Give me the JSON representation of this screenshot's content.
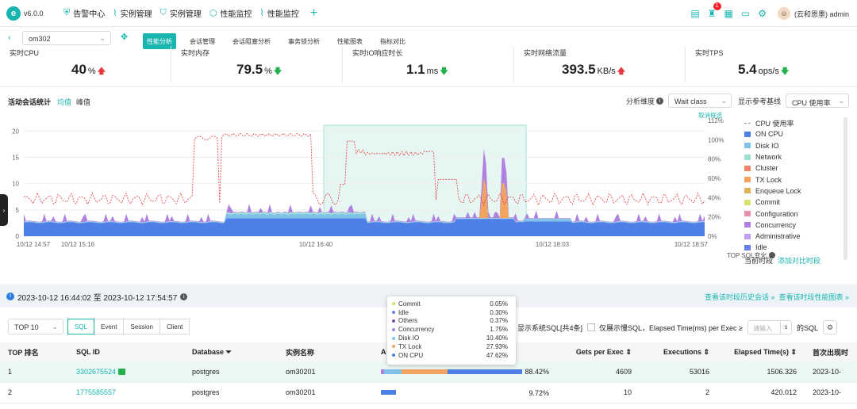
{
  "app": {
    "version": "v6.0.0",
    "brand_color": "#19b6b0"
  },
  "nav": {
    "items": [
      {
        "label": "告警中心",
        "icon": "shield-icon"
      },
      {
        "label": "实例管理",
        "icon": "pulse-icon"
      },
      {
        "label": "实例管理",
        "icon": "shield-icon"
      },
      {
        "label": "性能监控",
        "icon": "hexagon-icon"
      },
      {
        "label": "性能监控",
        "icon": "pulse-icon"
      }
    ],
    "add": "+"
  },
  "toolbar": {
    "notification_count": "1",
    "user": "(云和恩墨) admin"
  },
  "instance": {
    "selected": "om302"
  },
  "tabs": [
    "性能分析",
    "会话管理",
    "会话阻塞分析",
    "事务锁分析",
    "性能图表",
    "指标对比"
  ],
  "metrics": [
    {
      "label": "实时CPU",
      "value": "40",
      "unit": "%",
      "trend": "up"
    },
    {
      "label": "实时内存",
      "value": "79.5",
      "unit": "%",
      "trend": "down"
    },
    {
      "label": "实时IO响应时长",
      "value": "1.1",
      "unit": "ms",
      "trend": "down"
    },
    {
      "label": "实时网络流量",
      "value": "393.5",
      "unit": "KB/s",
      "trend": "up"
    },
    {
      "label": "实时TPS",
      "value": "5.4",
      "unit": "ops/s",
      "trend": "down"
    }
  ],
  "panel": {
    "title": "活动会话统计",
    "toggle_avg": "均值",
    "toggle_peak": "峰值",
    "dimension_label": "分析维度",
    "dimension_value": "Wait class",
    "baseline_label": "显示参考基线",
    "baseline_value": "CPU 使用率",
    "cancel_select": "取消框选",
    "current_period": "当前时段",
    "add_compare": "添加对比时段",
    "top_sql_change": "TOP SQL变化"
  },
  "chart_data": {
    "type": "area",
    "x_ticks": [
      "10/12 14:57",
      "10/12 15:16",
      "10/12 16:40",
      "10/12 18:03",
      "10/12 18:57"
    ],
    "y_ticks": [
      0,
      5,
      10,
      15,
      20
    ],
    "y_right_ticks": [
      "0%",
      "20%",
      "40%",
      "60%",
      "80%",
      "100%",
      "112%"
    ],
    "ylim": [
      0,
      22
    ],
    "series": [
      {
        "name": "CPU 使用率",
        "color": "#e8383d"
      },
      {
        "name": "ON CPU",
        "color": "#4d7fe6"
      },
      {
        "name": "Disk IO",
        "color": "#7fc1e8"
      },
      {
        "name": "Network",
        "color": "#9ee0d4"
      },
      {
        "name": "Cluster",
        "color": "#f0876a"
      },
      {
        "name": "TX Lock",
        "color": "#f0a460"
      },
      {
        "name": "Enqueue Lock",
        "color": "#e0b05a"
      },
      {
        "name": "Commit",
        "color": "#d8e070"
      },
      {
        "name": "Configuration",
        "color": "#e890a8"
      },
      {
        "name": "Concurrency",
        "color": "#b080e0"
      },
      {
        "name": "Administrative",
        "color": "#c0a0f0"
      },
      {
        "name": "Idle",
        "color": "#6a7fe8"
      }
    ]
  },
  "range": {
    "text": "2023-10-12 16:44:02 至 2023-10-12 17:54:57",
    "link1": "查看该时段历史会话 »",
    "link2": "查看该时段性能图表 »"
  },
  "bottom": {
    "top_select": "TOP 10",
    "btabs": [
      "SQL",
      "Event",
      "Session",
      "Client"
    ],
    "show_sys": "显示系统SQL[共4条]",
    "only_slow": "仅展示慢SQL，Elapsed Time(ms) per Exec ≥",
    "input_placeholder": "请输入",
    "unit": "s",
    "sql_suffix": "的SQL"
  },
  "table": {
    "headers": [
      "TOP 排名",
      "SQL ID",
      "Database",
      "实例名称",
      "A",
      "Gets per Exec",
      "Executions",
      "Elapsed Time(s)",
      "首次出现时"
    ],
    "rows": [
      {
        "rank": "1",
        "sql_id": "3302675524",
        "database": "postgres",
        "instance": "om30201",
        "pct": "88.42%",
        "gets": "4609",
        "exec": "53016",
        "elapsed": "1506.326",
        "first": "2023-10-"
      },
      {
        "rank": "2",
        "sql_id": "1775585557",
        "database": "postgres",
        "instance": "om30201",
        "pct": "9.72%",
        "gets": "10",
        "exec": "2",
        "elapsed": "420.012",
        "first": "2023-10-"
      }
    ]
  },
  "tooltip": [
    {
      "name": "Commit",
      "value": "0.05%",
      "color": "#d8e070"
    },
    {
      "name": "Idle",
      "value": "0.30%",
      "color": "#6a7fe8"
    },
    {
      "name": "Others",
      "value": "0.37%",
      "color": "#7a4fb0"
    },
    {
      "name": "Concurrency",
      "value": "1.75%",
      "color": "#b080e0"
    },
    {
      "name": "Disk IO",
      "value": "10.40%",
      "color": "#7fc1e8"
    },
    {
      "name": "TX Lock",
      "value": "27.93%",
      "color": "#f0a460"
    },
    {
      "name": "ON CPU",
      "value": "47.62%",
      "color": "#4d7fe6"
    }
  ]
}
